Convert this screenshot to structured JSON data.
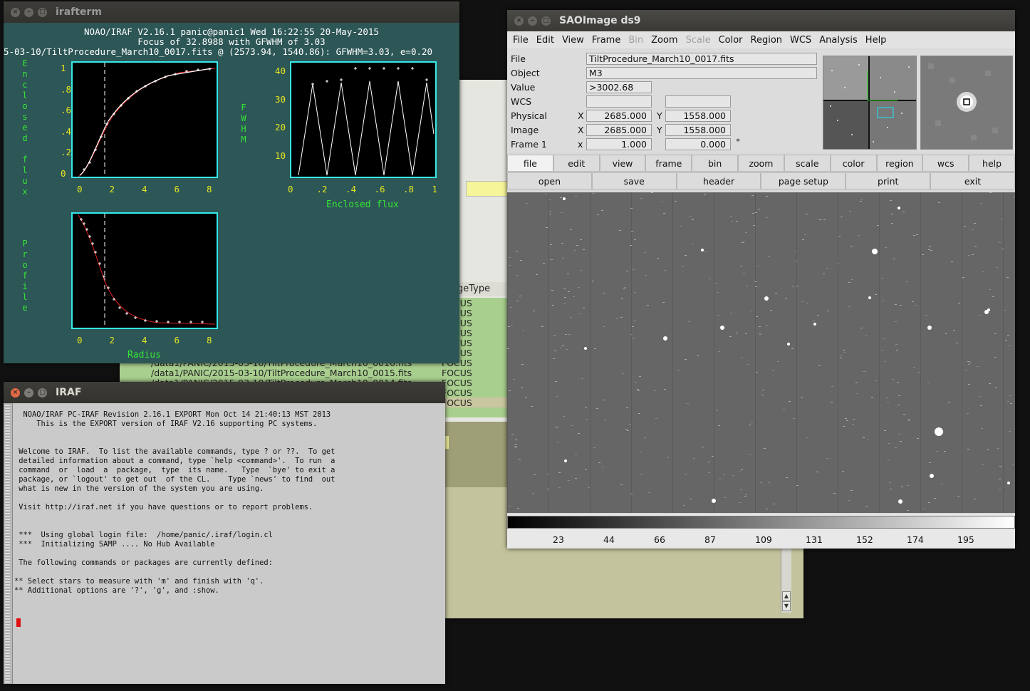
{
  "background_window": {
    "column_header": "geType",
    "rows": [
      {
        "path": "",
        "type": "FOCUS"
      },
      {
        "path": "",
        "type": "FOCUS"
      },
      {
        "path": "",
        "type": "FOCUS"
      },
      {
        "path": "",
        "type": "FOCUS"
      },
      {
        "path": "",
        "type": "FOCUS"
      },
      {
        "path": "",
        "type": "FOCUS"
      },
      {
        "path": "/data1/PANIC/2015-03-10/TiltProcedure_March10_0016.fits",
        "type": "FOCUS"
      },
      {
        "path": "/data1/PANIC/2015-03-10/TiltProcedure_March10_0015.fits",
        "type": "FOCUS"
      },
      {
        "path": "/data1/PANIC/2015-03-10/TiltProcedure_March10_0014.fits",
        "type": "FOCUS"
      },
      {
        "path": "",
        "type": "FOCUS"
      },
      {
        "path": "",
        "type": "FOCUS"
      }
    ]
  },
  "irafterm": {
    "title": "irafterm",
    "header_line1": "NOAO/IRAF V2.16.1 panic@panic1 Wed 16:22:55 20-May-2015",
    "header_line2": "Focus of 32.8988 with GFWHM of 3.03",
    "header_line3": "5-03-10/TiltProcedure_March10_0017.fits @ (2573.94, 1540.86): GFWHM=3.03, e=0.20",
    "enclosed_label": "Enclosed flux",
    "fwhm_label": "FWHM",
    "profile_label": "Profile",
    "radius_label": "Radius",
    "enclosed_xlabel": "Enclosed flux",
    "ticks_ef_y": [
      "1",
      ".8",
      ".6",
      ".4",
      ".2",
      "0"
    ],
    "ticks_radius": [
      "0",
      "2",
      "4",
      "6",
      "8"
    ],
    "ticks_fwhm_y": [
      "40",
      "30",
      "20",
      "10"
    ],
    "ticks_flux_x": [
      "0",
      ".2",
      ".4",
      ".6",
      ".8",
      "1"
    ]
  },
  "iraf": {
    "title": "IRAF",
    "lines": [
      "  NOAO/IRAF PC-IRAF Revision 2.16.1 EXPORT Mon Oct 14 21:40:13 MST 2013",
      "     This is the EXPORT version of IRAF V2.16 supporting PC systems.",
      "",
      "",
      " Welcome to IRAF.  To list the available commands, type ? or ??.  To get",
      " detailed information about a command, type `help <command>'.  To run  a",
      " command  or  load  a  package,  type  its name.   Type  `bye' to exit a",
      " package, or `logout' to get out  of the CL.    Type `news' to find  out",
      " what is new in the version of the system you are using.",
      "",
      " Visit http://iraf.net if you have questions or to report problems.",
      "",
      "",
      " ***  Using global login file:  /home/panic/.iraf/login.cl",
      " ***  Initializing SAMP .... No Hub Available",
      "",
      " The following commands or packages are currently defined:",
      "",
      "** Select stars to measure with 'm' and finish with 'q'.",
      "** Additional options are '?', 'g', and :show."
    ]
  },
  "ds9": {
    "title": "SAOImage ds9",
    "menu": [
      "File",
      "Edit",
      "View",
      "Frame",
      "Bin",
      "Zoom",
      "Scale",
      "Color",
      "Region",
      "WCS",
      "Analysis",
      "Help"
    ],
    "labels": {
      "file": "File",
      "object": "Object",
      "value": "Value",
      "wcs": "WCS",
      "physical": "Physical",
      "image": "Image",
      "frame": "Frame 1"
    },
    "values": {
      "file": "TiltProcedure_March10_0017.fits",
      "object": "M3",
      "value": ">3002.68",
      "physical_x": "2685.000",
      "physical_y": "1558.000",
      "image_x": "2685.000",
      "image_y": "1558.000",
      "zoom": "1.000",
      "angle": "0.000"
    },
    "axis_x": "X",
    "axis_y": "Y",
    "axis_x_lower": "x",
    "degree": "°",
    "buttons_row1": [
      "file",
      "edit",
      "view",
      "frame",
      "bin",
      "zoom",
      "scale",
      "color",
      "region",
      "wcs",
      "help"
    ],
    "buttons_row2": [
      "open",
      "save",
      "header",
      "page setup",
      "print",
      "exit"
    ],
    "colorbar_ticks": [
      "23",
      "44",
      "66",
      "87",
      "109",
      "131",
      "152",
      "174",
      "195"
    ]
  }
}
